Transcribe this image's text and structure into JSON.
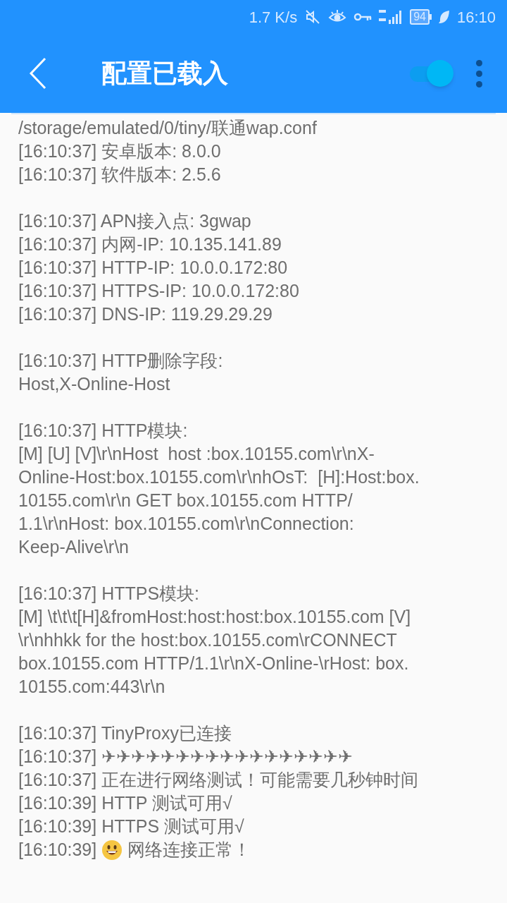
{
  "status_bar": {
    "speed": "1.7 K/s",
    "battery": "94",
    "time": "16:10"
  },
  "app_bar": {
    "title": "配置已载入",
    "toggle": {
      "on": true
    }
  },
  "log": [
    {
      "lines": [
        {
          "text": "/storage/emulated/0/tiny/联通wap.conf"
        },
        {
          "text": "[16:10:37] 安卓版本: 8.0.0"
        },
        {
          "text": "[16:10:37] 软件版本: 2.5.6"
        }
      ]
    },
    {
      "lines": [
        {
          "text": "[16:10:37] APN接入点: 3gwap"
        },
        {
          "text": "[16:10:37] 内网-IP: 10.135.141.89"
        },
        {
          "text": "[16:10:37] HTTP-IP: 10.0.0.172:80"
        },
        {
          "text": "[16:10:37] HTTPS-IP: 10.0.0.172:80"
        },
        {
          "text": "[16:10:37] DNS-IP: 119.29.29.29"
        }
      ]
    },
    {
      "lines": [
        {
          "text": "[16:10:37] HTTP删除字段:"
        },
        {
          "text": "Host,X-Online-Host"
        }
      ]
    },
    {
      "lines": [
        {
          "text": "[16:10:37] HTTP模块:"
        },
        {
          "text": "[M] [U] [V]\\r\\nHost  host :box.10155.com\\r\\nX-"
        },
        {
          "text": "Online-Host:box.10155.com\\r\\nhOsT:  [H]:Host:box."
        },
        {
          "text": "10155.com\\r\\n GET box.10155.com HTTP/"
        },
        {
          "text": "1.1\\r\\nHost: box.10155.com\\r\\nConnection:"
        },
        {
          "text": "Keep-Alive\\r\\n"
        }
      ]
    },
    {
      "lines": [
        {
          "text": "[16:10:37] HTTPS模块:"
        },
        {
          "text": "[M] \\t\\t\\t[H]&fromHost:host:host:box.10155.com [V]"
        },
        {
          "text": "\\r\\nhhkk for the host:box.10155.com\\rCONNECT"
        },
        {
          "text": "box.10155.com HTTP/1.1\\r\\nX-Online-\\rHost: box."
        },
        {
          "text": "10155.com:443\\r\\n"
        }
      ]
    },
    {
      "lines": [
        {
          "text": "[16:10:37] TinyProxy已连接"
        },
        {
          "text": "[16:10:37] ✈✈✈✈✈✈✈✈✈✈✈✈✈✈✈✈✈"
        },
        {
          "text": "[16:10:37] 正在进行网络测试！可能需要几秒钟时间"
        },
        {
          "text": "[16:10:39] HTTP 测试可用√"
        },
        {
          "text": "[16:10:39] HTTPS 测试可用√"
        },
        {
          "kind": "emoji",
          "before": "[16:10:39]",
          "after": "网络连接正常！"
        }
      ]
    }
  ]
}
